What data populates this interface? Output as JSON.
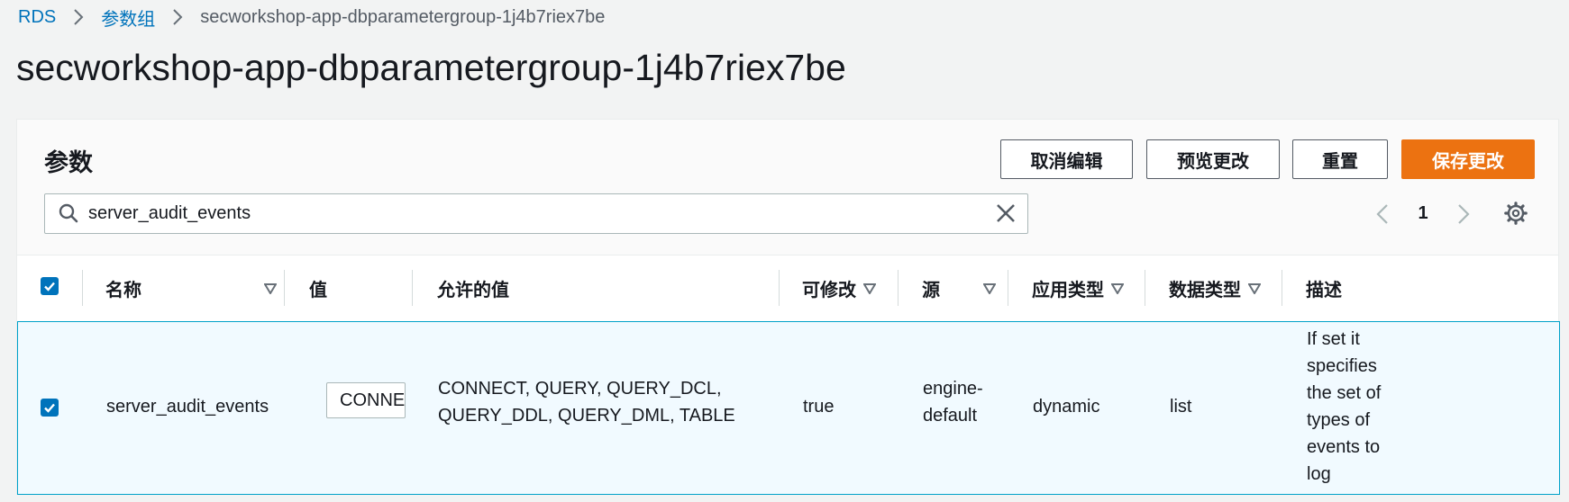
{
  "breadcrumb": {
    "items": [
      "RDS",
      "参数组"
    ],
    "current": "secworkshop-app-dbparametergroup-1j4b7riex7be"
  },
  "page_title": "secworkshop-app-dbparametergroup-1j4b7riex7be",
  "panel": {
    "title": "参数",
    "buttons": {
      "cancel": "取消编辑",
      "preview": "预览更改",
      "reset": "重置",
      "save": "保存更改"
    }
  },
  "search": {
    "value": "server_audit_events",
    "icon": "search-icon",
    "clear_icon": "close-icon"
  },
  "pagination": {
    "current_page": "1"
  },
  "table": {
    "columns": [
      "名称",
      "值",
      "允许的值",
      "可修改",
      "源",
      "应用类型",
      "数据类型",
      "描述"
    ],
    "header_checkbox_checked": true,
    "rows": [
      {
        "checked": true,
        "name": "server_audit_events",
        "value": "CONNECT, QUERY, QUERY_DCL, QUERY_DDL, QUERY_DML, TABLE",
        "allowed_values": [
          "CONNECT, QUERY, QUERY_DCL,",
          "QUERY_DDL, QUERY_DML, TABLE"
        ],
        "modifiable": "true",
        "source": [
          "engine-",
          "default"
        ],
        "apply_type": "dynamic",
        "data_type": "list",
        "description": [
          "If set it",
          "specifies",
          "the set of",
          "types of",
          "events to",
          "log"
        ]
      }
    ]
  },
  "colors": {
    "link": "#0073bb",
    "primary_button": "#ec7211",
    "checkbox": "#0073bb",
    "selected_row_bg": "#f1faff",
    "selected_row_border": "#00a1c9"
  }
}
